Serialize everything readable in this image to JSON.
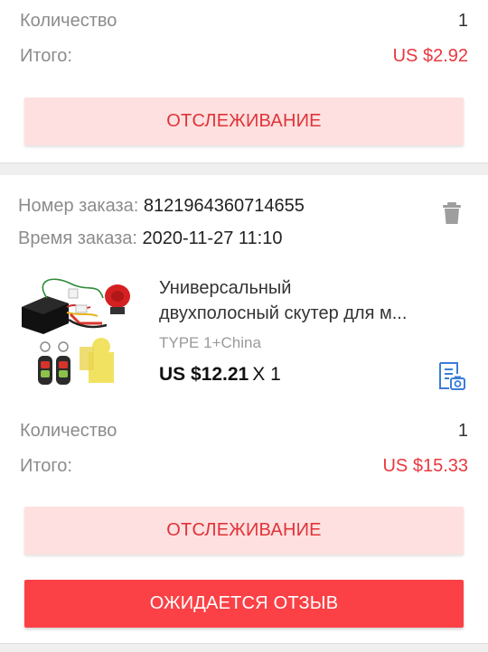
{
  "previous_order": {
    "quantity_label": "Количество",
    "quantity_value": "1",
    "total_label": "Итого:",
    "total_value": "US $2.92",
    "track_button": "ОТСЛЕЖИВАНИЕ"
  },
  "order": {
    "number_label": "Номер заказа:",
    "number_value": "8121964360714655",
    "time_label": "Время заказа:",
    "time_value": "2020-11-27 11:10",
    "product": {
      "title_line1": "Универсальный",
      "title_line2": "двухполосный скутер для м...",
      "variant": "TYPE 1+China",
      "price": "US $12.21",
      "multiplier": "X 1"
    },
    "quantity_label": "Количество",
    "quantity_value": "1",
    "total_label": "Итого:",
    "total_value": "US $15.33",
    "track_button": "ОТСЛЕЖИВАНИЕ",
    "review_button": "ОЖИДАЕТСЯ ОТЗЫВ"
  },
  "colors": {
    "accent": "#e9383f",
    "track_bg": "#fde0df",
    "review_bg": "#fb4146",
    "icon_blue": "#3b7dd8"
  },
  "icons": {
    "delete": "trash-icon",
    "receipt": "receipt-photo-icon"
  }
}
